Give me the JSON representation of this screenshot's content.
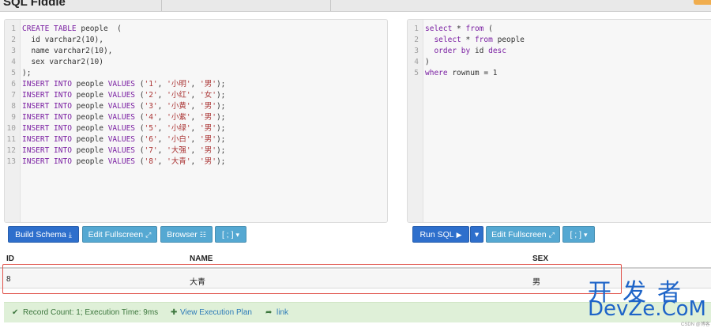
{
  "header": {
    "brand": "SQL Fiddle"
  },
  "schema_editor": {
    "lines": [
      {
        "n": "1",
        "parts": [
          {
            "t": "kw",
            "v": "CREATE TABLE"
          },
          {
            "t": "op",
            "v": " people  ("
          }
        ]
      },
      {
        "n": "2",
        "parts": [
          {
            "t": "op",
            "v": "  id varchar2(10),"
          }
        ]
      },
      {
        "n": "3",
        "parts": [
          {
            "t": "op",
            "v": "  name varchar2(10),"
          }
        ]
      },
      {
        "n": "4",
        "parts": [
          {
            "t": "op",
            "v": "  sex varchar2(10)"
          }
        ]
      },
      {
        "n": "5",
        "parts": [
          {
            "t": "op",
            "v": ");"
          }
        ]
      },
      {
        "n": "6",
        "parts": [
          {
            "t": "kw",
            "v": "INSERT INTO"
          },
          {
            "t": "op",
            "v": " people "
          },
          {
            "t": "kw",
            "v": "VALUES"
          },
          {
            "t": "op",
            "v": " ("
          },
          {
            "t": "str",
            "v": "'1'"
          },
          {
            "t": "op",
            "v": ", "
          },
          {
            "t": "str",
            "v": "'小明'"
          },
          {
            "t": "op",
            "v": ", "
          },
          {
            "t": "str",
            "v": "'男'"
          },
          {
            "t": "op",
            "v": ");"
          }
        ]
      },
      {
        "n": "7",
        "parts": [
          {
            "t": "kw",
            "v": "INSERT INTO"
          },
          {
            "t": "op",
            "v": " people "
          },
          {
            "t": "kw",
            "v": "VALUES"
          },
          {
            "t": "op",
            "v": " ("
          },
          {
            "t": "str",
            "v": "'2'"
          },
          {
            "t": "op",
            "v": ", "
          },
          {
            "t": "str",
            "v": "'小红'"
          },
          {
            "t": "op",
            "v": ", "
          },
          {
            "t": "str",
            "v": "'女'"
          },
          {
            "t": "op",
            "v": ");"
          }
        ]
      },
      {
        "n": "8",
        "parts": [
          {
            "t": "kw",
            "v": "INSERT INTO"
          },
          {
            "t": "op",
            "v": " people "
          },
          {
            "t": "kw",
            "v": "VALUES"
          },
          {
            "t": "op",
            "v": " ("
          },
          {
            "t": "str",
            "v": "'3'"
          },
          {
            "t": "op",
            "v": ", "
          },
          {
            "t": "str",
            "v": "'小黄'"
          },
          {
            "t": "op",
            "v": ", "
          },
          {
            "t": "str",
            "v": "'男'"
          },
          {
            "t": "op",
            "v": ");"
          }
        ]
      },
      {
        "n": "9",
        "parts": [
          {
            "t": "kw",
            "v": "INSERT INTO"
          },
          {
            "t": "op",
            "v": " people "
          },
          {
            "t": "kw",
            "v": "VALUES"
          },
          {
            "t": "op",
            "v": " ("
          },
          {
            "t": "str",
            "v": "'4'"
          },
          {
            "t": "op",
            "v": ", "
          },
          {
            "t": "str",
            "v": "'小紫'"
          },
          {
            "t": "op",
            "v": ", "
          },
          {
            "t": "str",
            "v": "'男'"
          },
          {
            "t": "op",
            "v": ");"
          }
        ]
      },
      {
        "n": "10",
        "parts": [
          {
            "t": "kw",
            "v": "INSERT INTO"
          },
          {
            "t": "op",
            "v": " people "
          },
          {
            "t": "kw",
            "v": "VALUES"
          },
          {
            "t": "op",
            "v": " ("
          },
          {
            "t": "str",
            "v": "'5'"
          },
          {
            "t": "op",
            "v": ", "
          },
          {
            "t": "str",
            "v": "'小绿'"
          },
          {
            "t": "op",
            "v": ", "
          },
          {
            "t": "str",
            "v": "'男'"
          },
          {
            "t": "op",
            "v": ");"
          }
        ]
      },
      {
        "n": "11",
        "parts": [
          {
            "t": "kw",
            "v": "INSERT INTO"
          },
          {
            "t": "op",
            "v": " people "
          },
          {
            "t": "kw",
            "v": "VALUES"
          },
          {
            "t": "op",
            "v": " ("
          },
          {
            "t": "str",
            "v": "'6'"
          },
          {
            "t": "op",
            "v": ", "
          },
          {
            "t": "str",
            "v": "'小白'"
          },
          {
            "t": "op",
            "v": ", "
          },
          {
            "t": "str",
            "v": "'男'"
          },
          {
            "t": "op",
            "v": ");"
          }
        ]
      },
      {
        "n": "12",
        "parts": [
          {
            "t": "kw",
            "v": "INSERT INTO"
          },
          {
            "t": "op",
            "v": " people "
          },
          {
            "t": "kw",
            "v": "VALUES"
          },
          {
            "t": "op",
            "v": " ("
          },
          {
            "t": "str",
            "v": "'7'"
          },
          {
            "t": "op",
            "v": ", "
          },
          {
            "t": "str",
            "v": "'大强'"
          },
          {
            "t": "op",
            "v": ", "
          },
          {
            "t": "str",
            "v": "'男'"
          },
          {
            "t": "op",
            "v": ");"
          }
        ]
      },
      {
        "n": "13",
        "parts": [
          {
            "t": "kw",
            "v": "INSERT INTO"
          },
          {
            "t": "op",
            "v": " people "
          },
          {
            "t": "kw",
            "v": "VALUES"
          },
          {
            "t": "op",
            "v": " ("
          },
          {
            "t": "str",
            "v": "'8'"
          },
          {
            "t": "op",
            "v": ", "
          },
          {
            "t": "str",
            "v": "'大青'"
          },
          {
            "t": "op",
            "v": ", "
          },
          {
            "t": "str",
            "v": "'男'"
          },
          {
            "t": "op",
            "v": ");"
          }
        ]
      }
    ]
  },
  "query_editor": {
    "lines": [
      {
        "n": "1",
        "parts": [
          {
            "t": "kw",
            "v": "select"
          },
          {
            "t": "op",
            "v": " * "
          },
          {
            "t": "kw",
            "v": "from"
          },
          {
            "t": "op",
            "v": " ("
          }
        ]
      },
      {
        "n": "2",
        "parts": [
          {
            "t": "op",
            "v": "  "
          },
          {
            "t": "kw",
            "v": "select"
          },
          {
            "t": "op",
            "v": " * "
          },
          {
            "t": "kw",
            "v": "from"
          },
          {
            "t": "op",
            "v": " people"
          }
        ]
      },
      {
        "n": "3",
        "parts": [
          {
            "t": "op",
            "v": "  "
          },
          {
            "t": "kw",
            "v": "order by"
          },
          {
            "t": "op",
            "v": " id "
          },
          {
            "t": "kw",
            "v": "desc"
          }
        ]
      },
      {
        "n": "4",
        "parts": [
          {
            "t": "op",
            "v": ")"
          }
        ]
      },
      {
        "n": "5",
        "parts": [
          {
            "t": "kw",
            "v": "where"
          },
          {
            "t": "op",
            "v": " rownum = 1"
          }
        ]
      }
    ]
  },
  "schema_toolbar": {
    "build_label": "Build Schema",
    "fullscreen_label": "Edit Fullscreen",
    "browser_label": "Browser",
    "delim_label": "[ ; ]"
  },
  "query_toolbar": {
    "run_label": "Run SQL",
    "fullscreen_label": "Edit Fullscreen",
    "delim_label": "[ ; ]"
  },
  "results": {
    "columns": [
      "ID",
      "NAME",
      "SEX"
    ],
    "rows": [
      [
        "8",
        "大青",
        "男"
      ]
    ]
  },
  "status": {
    "record_text": "Record Count: 1; Execution Time: 9ms",
    "plan_label": "View Execution Plan",
    "link_label": "link"
  },
  "watermark": {
    "cn": "开发者",
    "en": "DevZe.CoM",
    "small": "CSDN @博客"
  },
  "colors": {
    "primary": "#2e6fcc",
    "info": "#55a8d2",
    "success_bg": "#dff0d8",
    "highlight": "#e0544c"
  }
}
